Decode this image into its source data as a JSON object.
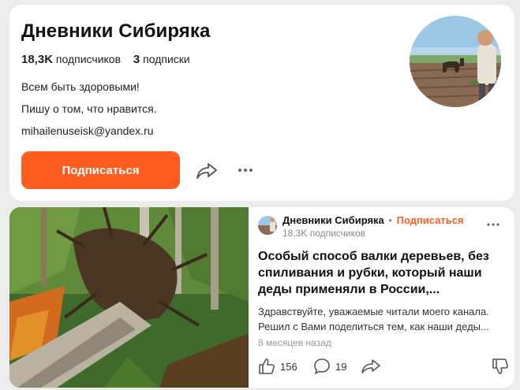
{
  "channel": {
    "title": "Дневники Сибиряка",
    "subscribers_count": "18,3K",
    "subscribers_label": "подписчиков",
    "subscriptions_count": "3",
    "subscriptions_label": "подписки",
    "description_lines": [
      "Всем быть здоровыми!",
      "Пишу о том, что нравится.",
      "mihailenuseisk@yandex.ru"
    ],
    "subscribe_label": "Подписаться"
  },
  "post": {
    "author_name": "Дневники Сибиряка",
    "author_separator": "•",
    "author_subscribe": "Подписаться",
    "author_followers": "18,3K подписчиков",
    "title": "Особый способ валки деревьев, без спиливания и рубки, который наши деды применяли в России,...",
    "snippet_lines": [
      "Здравствуйте, уважаемые читали моего канала.",
      "Решил с Вами поделиться тем, как наши деды..."
    ],
    "date": "8 месяцев назад",
    "likes": "156",
    "comments": "19"
  },
  "colors": {
    "accent": "#ff5d1f",
    "page_bg": "#ececec",
    "card_bg": "#ffffff"
  },
  "icons": {
    "share": "share-arrow-icon",
    "more": "ellipsis-icon",
    "like": "thumbs-up-icon",
    "comment": "comment-bubble-icon",
    "dislike": "thumbs-down-icon"
  }
}
